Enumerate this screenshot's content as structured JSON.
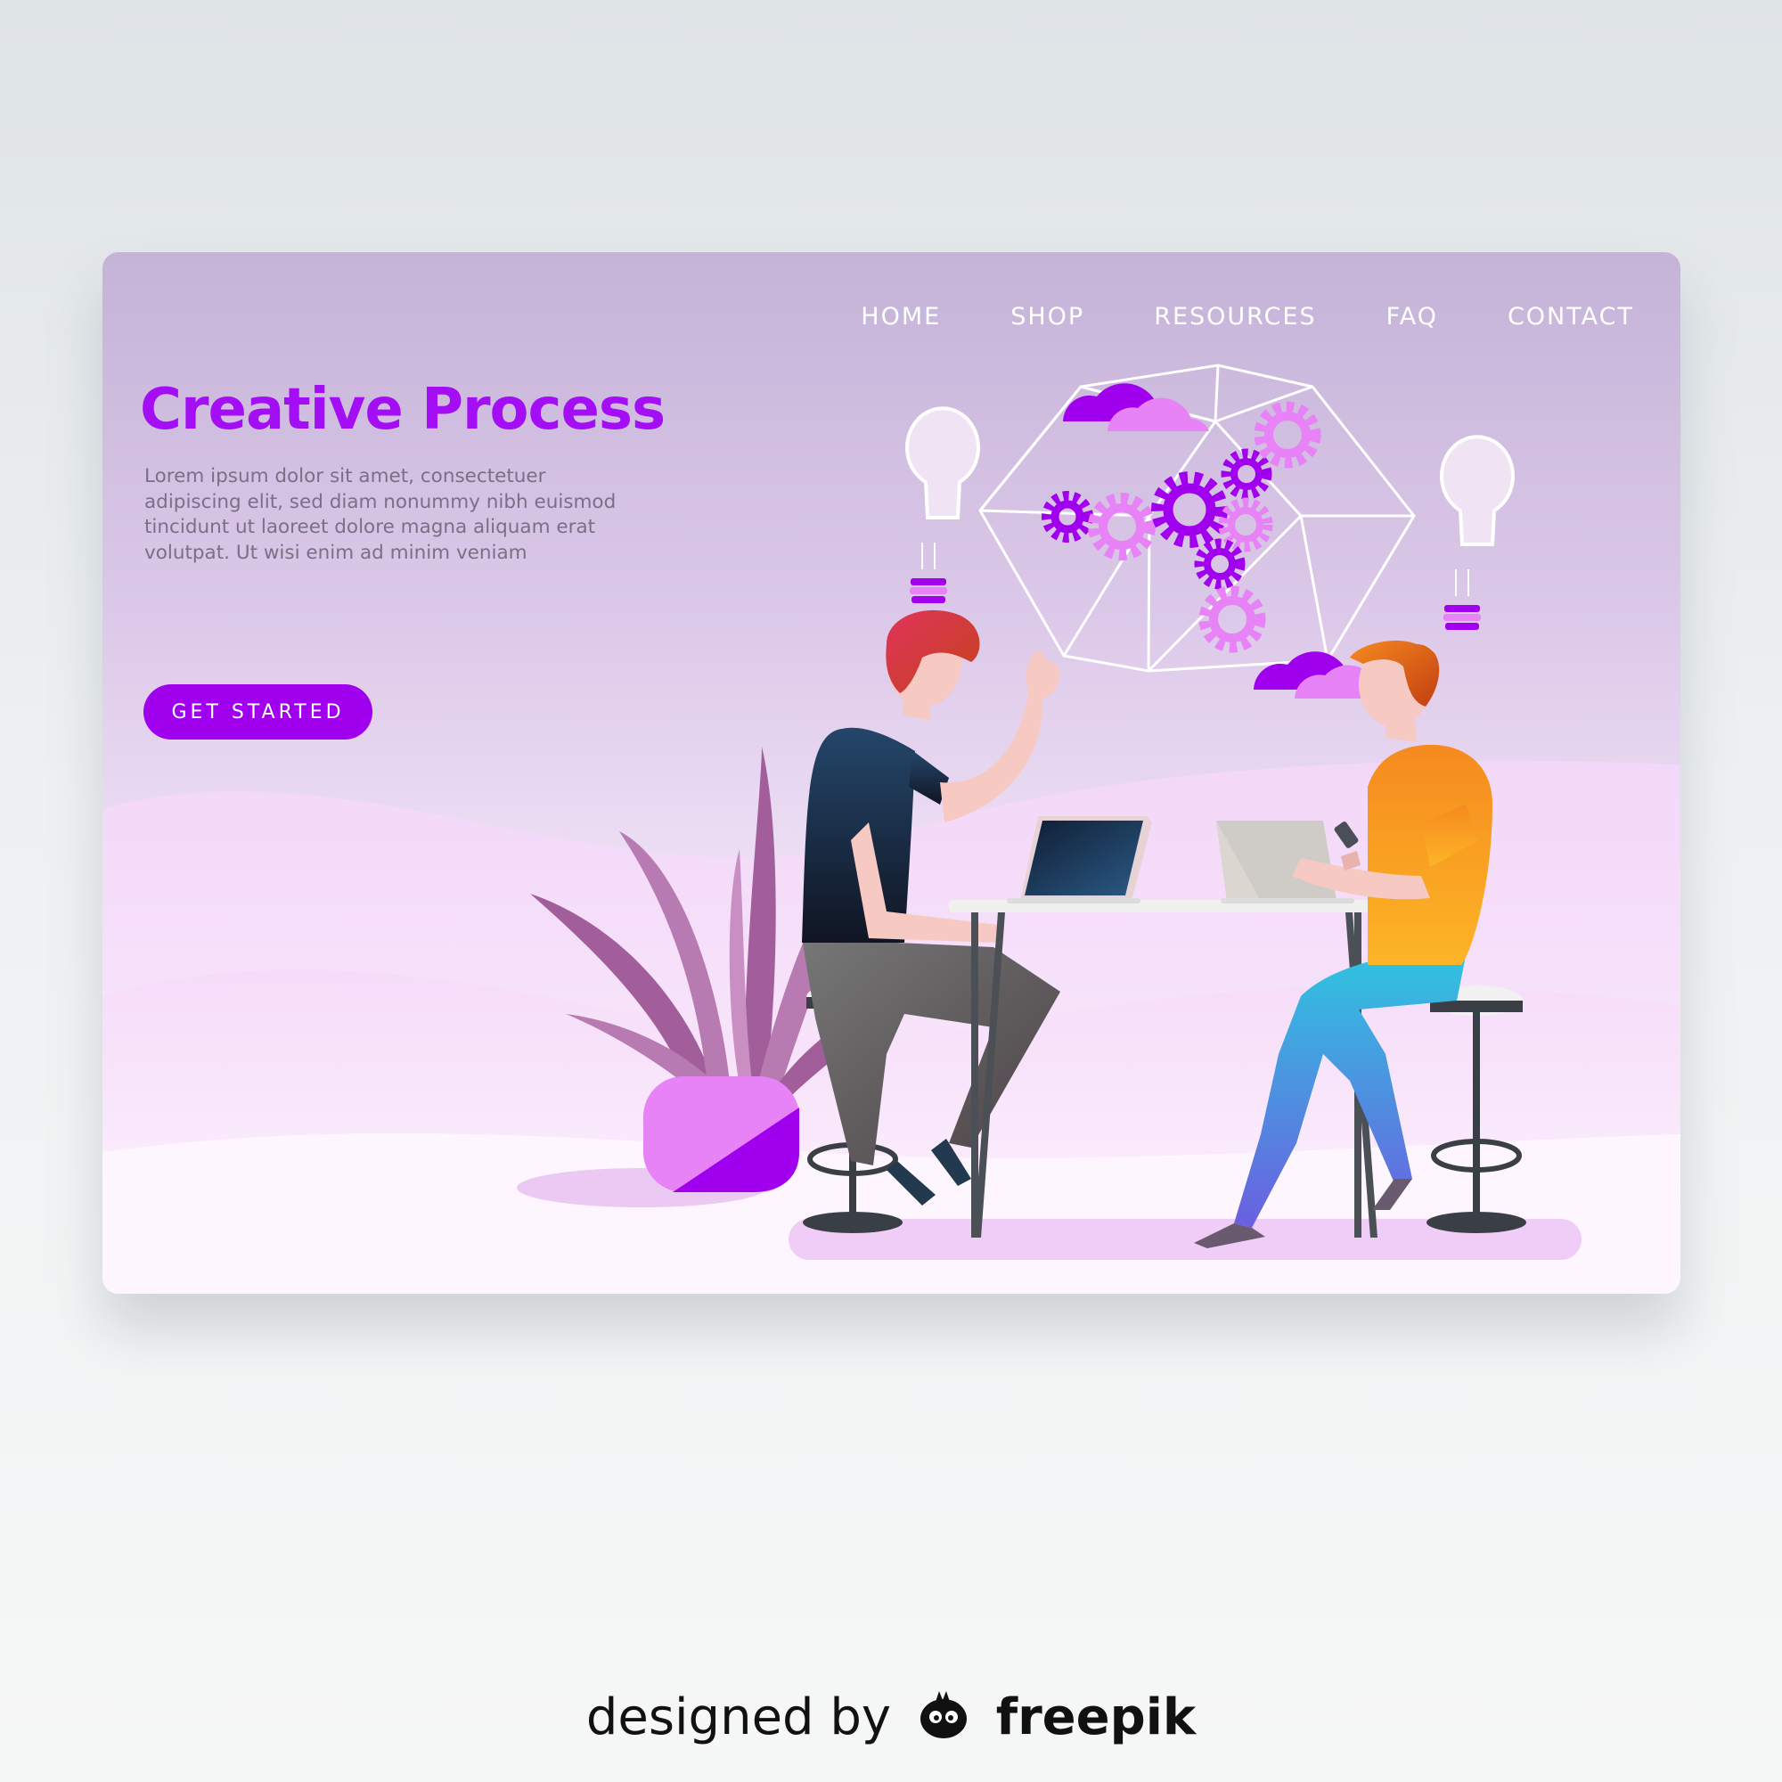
{
  "nav": {
    "items": [
      {
        "label": "HOME"
      },
      {
        "label": "SHOP"
      },
      {
        "label": "RESOURCES"
      },
      {
        "label": "FAQ"
      },
      {
        "label": "CONTACT"
      }
    ]
  },
  "hero": {
    "title": "Creative Process",
    "body": "Lorem ipsum dolor sit amet, consectetuer adipiscing elit, sed diam nonummy nibh euismod tincidunt ut laoreet dolore magna aliquam erat volutpat. Ut wisi enim ad minim veniam",
    "cta_label": "GET STARTED"
  },
  "credit": {
    "prefix": "designed by",
    "brand": "freepik"
  },
  "colors": {
    "accent": "#a000ee",
    "title": "#a30ef5",
    "nav_text": "#ffffff"
  },
  "icons": [
    "freepik-logo-icon",
    "lightbulb-icon",
    "gear-icon",
    "cloud-icon"
  ]
}
